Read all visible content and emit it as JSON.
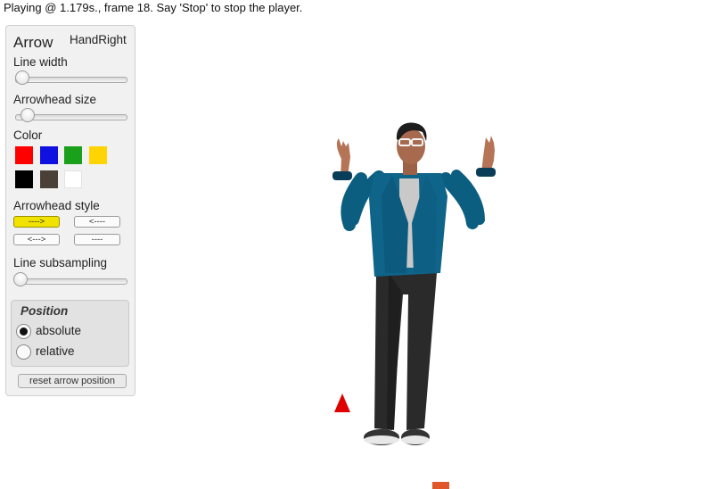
{
  "status": "Playing @ 1.179s., frame 18. Say 'Stop' to stop the player.",
  "panel": {
    "title": "Arrow",
    "target": "HandRight",
    "line_width_label": "Line width",
    "line_width_value": 0.0,
    "arrowhead_size_label": "Arrowhead size",
    "arrowhead_size_value": 0.05,
    "color_label": "Color",
    "colors": [
      "#ff0000",
      "#1010e0",
      "#1aa01a",
      "#ffd400",
      "#000000",
      "#4a4038",
      "#ffffff"
    ],
    "selected_color": "#ffd400",
    "arrowhead_style_label": "Arrowhead style",
    "styles": [
      "---->",
      "<----",
      "<--->",
      "----"
    ],
    "active_style": "---->",
    "line_subsampling_label": "Line subsampling",
    "line_subsampling_value": 0.0,
    "position": {
      "title": "Position",
      "options": [
        "absolute",
        "relative"
      ],
      "selected": "absolute"
    },
    "reset_label": "reset arrow position"
  },
  "scene": {
    "figure": "avatar-3d-man",
    "marker_color": "#e00000",
    "ground_marker_color": "#e0582a"
  }
}
